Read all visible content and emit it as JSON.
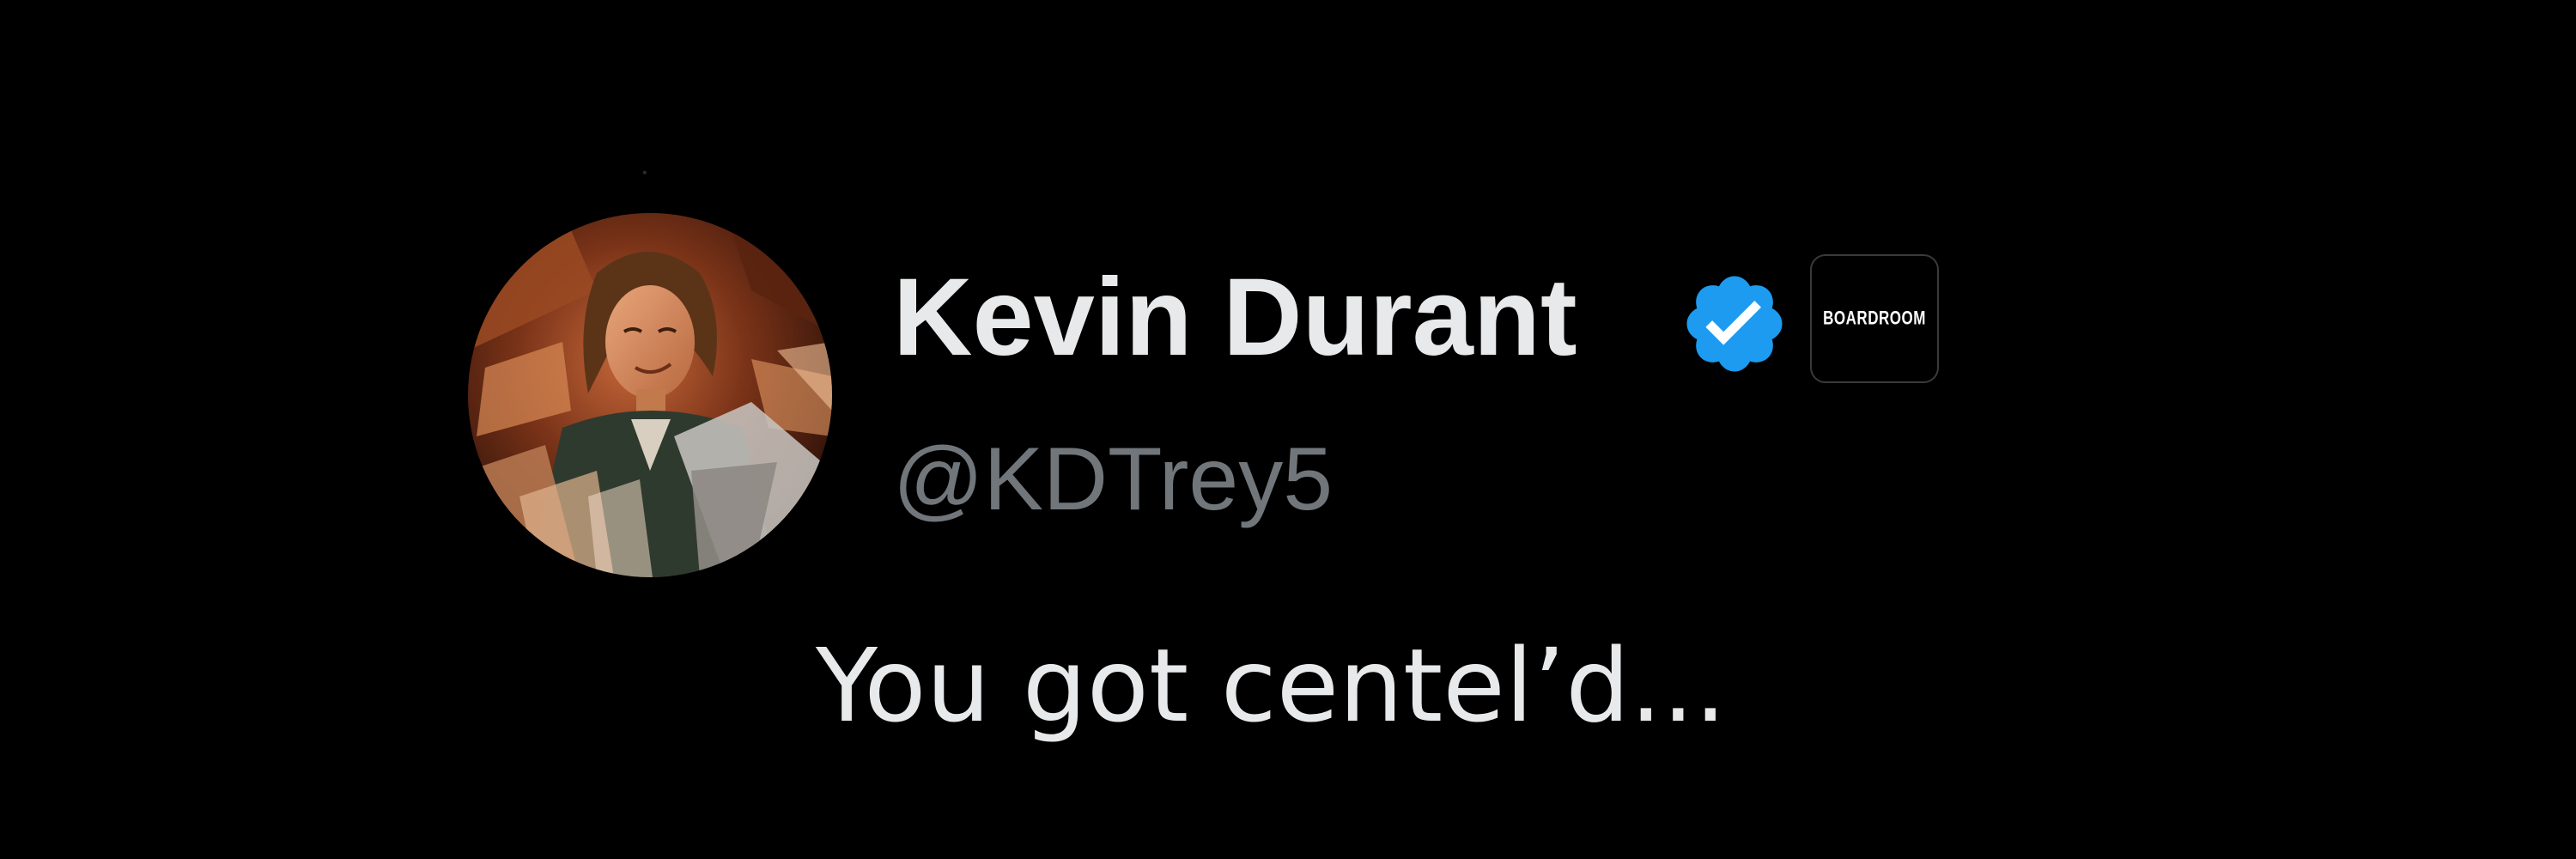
{
  "tweet": {
    "author": {
      "display_name": "Kevin Durant",
      "handle": "@KDTrey5",
      "verified_icon": "verified-check-icon",
      "verified_color": "#1d9bf0",
      "affiliate_label": "BOARDROOM"
    },
    "text": "You got centel’d..."
  },
  "colors": {
    "background": "#000000",
    "primary_text": "#e7e9ea",
    "secondary_text": "#71767b"
  }
}
